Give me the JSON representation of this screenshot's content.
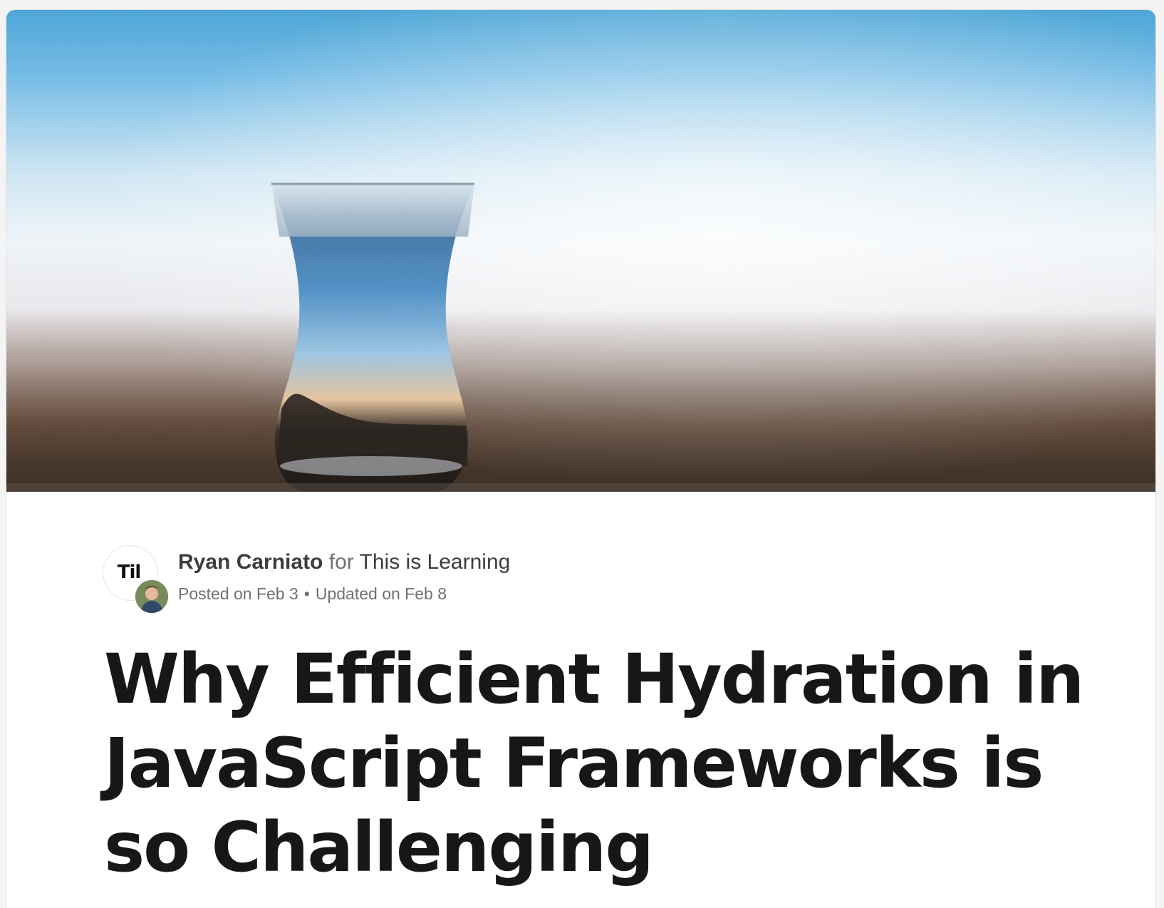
{
  "article": {
    "cover_image_icon": "cover-photo-glass-with-sky",
    "org_avatar_text": "Til",
    "author_name": "Ryan Carniato",
    "for_label": "for",
    "org_name": "This is Learning",
    "posted_label": "Posted on Feb 3",
    "separator": "•",
    "updated_label": "Updated on Feb 8",
    "title": "Why Efficient Hydration in JavaScript Frameworks is so Challenging"
  },
  "colors": {
    "title_text": "#171717",
    "meta_text": "#717171",
    "author_text": "#3d3d3d",
    "card_background": "#ffffff"
  }
}
